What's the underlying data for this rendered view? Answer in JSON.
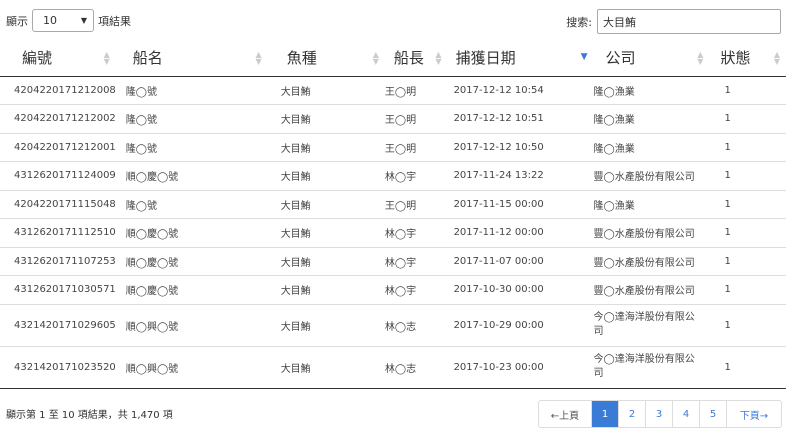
{
  "length_menu": {
    "prefix": "顯示",
    "value": "10",
    "suffix": "項結果"
  },
  "search": {
    "label": "搜索:",
    "value": "大目鮪"
  },
  "columns": [
    "編號",
    "船名",
    "魚種",
    "船長",
    "捕獲日期",
    "公司",
    "狀態"
  ],
  "rows": [
    [
      "4204220171212008",
      "隆◯號",
      "大目鮪",
      "王◯明",
      "2017-12-12 10:54",
      "隆◯漁業",
      "1"
    ],
    [
      "4204220171212002",
      "隆◯號",
      "大目鮪",
      "王◯明",
      "2017-12-12 10:51",
      "隆◯漁業",
      "1"
    ],
    [
      "4204220171212001",
      "隆◯號",
      "大目鮪",
      "王◯明",
      "2017-12-12 10:50",
      "隆◯漁業",
      "1"
    ],
    [
      "4312620171124009",
      "順◯慶◯號",
      "大目鮪",
      "林◯宇",
      "2017-11-24 13:22",
      "豐◯水產股份有限公司",
      "1"
    ],
    [
      "4204220171115048",
      "隆◯號",
      "大目鮪",
      "王◯明",
      "2017-11-15 00:00",
      "隆◯漁業",
      "1"
    ],
    [
      "4312620171112510",
      "順◯慶◯號",
      "大目鮪",
      "林◯宇",
      "2017-11-12 00:00",
      "豐◯水產股份有限公司",
      "1"
    ],
    [
      "4312620171107253",
      "順◯慶◯號",
      "大目鮪",
      "林◯宇",
      "2017-11-07 00:00",
      "豐◯水產股份有限公司",
      "1"
    ],
    [
      "4312620171030571",
      "順◯慶◯號",
      "大目鮪",
      "林◯宇",
      "2017-10-30 00:00",
      "豐◯水產股份有限公司",
      "1"
    ],
    [
      "4321420171029605",
      "順◯興◯號",
      "大目鮪",
      "林◯志",
      "2017-10-29 00:00",
      "今◯達海洋股份有限公司",
      "1"
    ],
    [
      "4321420171023520",
      "順◯興◯號",
      "大目鮪",
      "林◯志",
      "2017-10-23 00:00",
      "今◯達海洋股份有限公司",
      "1"
    ]
  ],
  "info": "顯示第 1 至 10 項結果，共 1,470 項",
  "pagination": {
    "prev": "←上頁",
    "pages": [
      "1",
      "2",
      "3",
      "4",
      "5"
    ],
    "active": "1",
    "next": "下頁→"
  },
  "colors": {
    "accent": "#3a7bd5"
  },
  "icons": {
    "sort": "sort-both-icon",
    "sort_desc": "sort-desc-icon",
    "caret": "chevron-down-icon"
  }
}
